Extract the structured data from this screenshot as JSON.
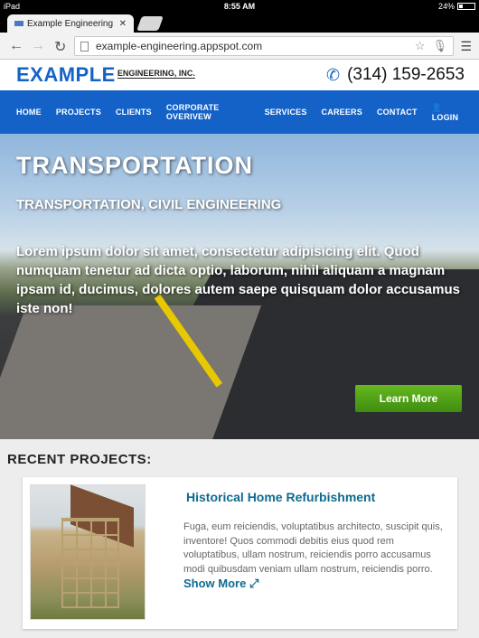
{
  "status_bar": {
    "device": "iPad",
    "time": "8:55 AM",
    "battery": "24%",
    "battery_level": 0.24
  },
  "browser": {
    "tab_title": "Example Engineering - Le",
    "url": "example-engineering.appspot.com"
  },
  "site": {
    "logo_main": "EXAMPLE",
    "logo_sub": "ENGINEERING, INC.",
    "phone": "(314) 159-2653",
    "nav": [
      "HOME",
      "PROJECTS",
      "CLIENTS",
      "CORPORATE OVERIVEW",
      "SERVICES",
      "CAREERS",
      "CONTACT",
      "LOGIN"
    ]
  },
  "hero": {
    "title": "TRANSPORTATION",
    "subtitle": "TRANSPORTATION, CIVIL ENGINEERING",
    "text": "Lorem ipsum dolor sit amet, consectetur adipisicing elit. Quod numquam tenetur ad dicta optio, laborum, nihil aliquam a magnam ipsam id, ducimus, dolores autem saepe quisquam dolor accusamus iste non!",
    "button": "Learn More"
  },
  "recent": {
    "heading": "RECENT PROJECTS:",
    "project_title": "Historical Home Refurbishment",
    "project_text": "Fuga, eum reiciendis, voluptatibus architecto, suscipit quis, inventore! Quos commodi debitis eius quod rem voluptatibus, ullam nostrum, reiciendis porro accusamus modi quibusdam veniam ullam nostrum, reiciendis porro.",
    "show_more": "Show More"
  }
}
